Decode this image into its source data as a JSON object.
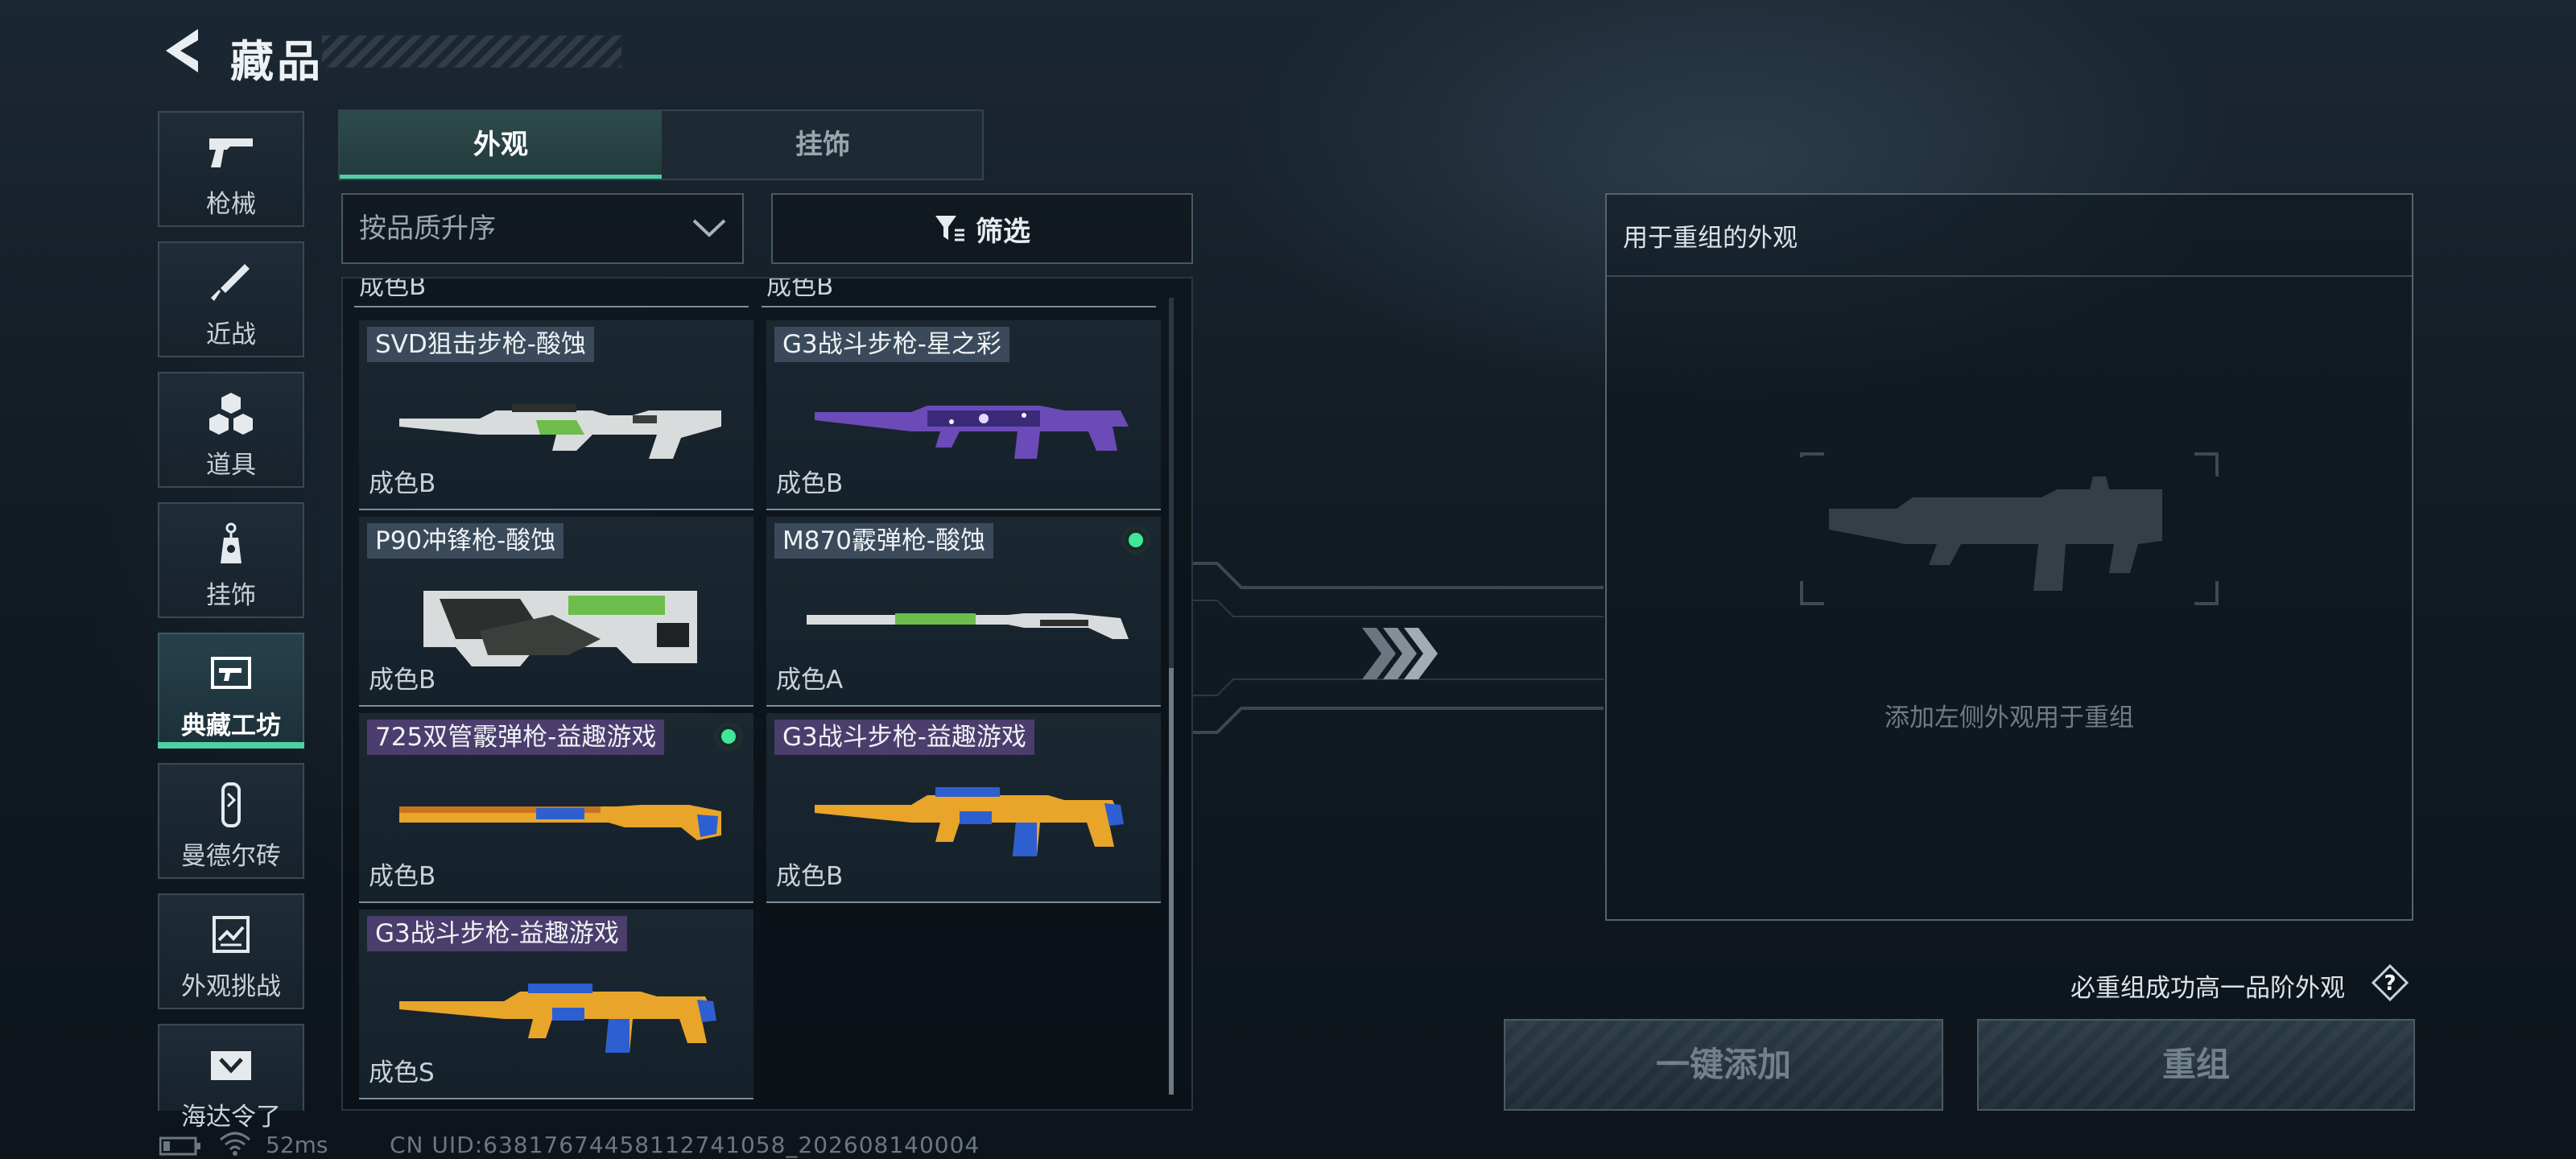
{
  "header": {
    "title": "藏品"
  },
  "sidebar": {
    "items": [
      {
        "label": "枪械",
        "icon": "pistol-icon",
        "active": false
      },
      {
        "label": "近战",
        "icon": "knife-icon",
        "active": false
      },
      {
        "label": "道具",
        "icon": "items-cubes-icon",
        "active": false
      },
      {
        "label": "挂饰",
        "icon": "charm-icon",
        "active": false
      },
      {
        "label": "典藏工坊",
        "icon": "workshop-icon",
        "active": true
      },
      {
        "label": "曼德尔砖",
        "icon": "mandel-brick-icon",
        "active": false
      },
      {
        "label": "外观挑战",
        "icon": "challenge-icon",
        "active": false
      },
      {
        "label": "海达令了",
        "icon": "gift-icon",
        "active": false
      }
    ]
  },
  "tabs": {
    "appearance": "外观",
    "pendant": "挂饰",
    "selected": "外观"
  },
  "controls": {
    "sort_label": "按品质升序",
    "filter_label": "筛选"
  },
  "grid": {
    "peek": [
      "成色B",
      "成色B"
    ],
    "cards": [
      {
        "name": "SVD狙击步枪-酸蚀",
        "quality": "成色B",
        "owned": false,
        "skin": "acid"
      },
      {
        "name": "G3战斗步枪-星之彩",
        "quality": "成色B",
        "owned": false,
        "skin": "galaxy"
      },
      {
        "name": "P90冲锋枪-酸蚀",
        "quality": "成色B",
        "owned": false,
        "skin": "acid"
      },
      {
        "name": "M870霰弹枪-酸蚀",
        "quality": "成色A",
        "owned": true,
        "skin": "acid"
      },
      {
        "name": "725双管霰弹枪-益趣游戏",
        "quality": "成色B",
        "owned": true,
        "skin": "fun"
      },
      {
        "name": "G3战斗步枪-益趣游戏",
        "quality": "成色B",
        "owned": false,
        "skin": "fun"
      },
      {
        "name": "G3战斗步枪-益趣游戏",
        "quality": "成色S",
        "owned": false,
        "skin": "fun"
      }
    ]
  },
  "panel": {
    "title": "用于重组的外观",
    "hint": "添加左侧外观用于重组"
  },
  "must_note": "必重组成功高一品阶外观",
  "buttons": {
    "add": "一键添加",
    "recompose": "重组"
  },
  "status": {
    "ping": "52ms",
    "uid": "CN UID:638176744581127410​58_202608140004"
  },
  "colors": {
    "accent": "#4fd0a3",
    "owned_dot": "#3ee898"
  }
}
